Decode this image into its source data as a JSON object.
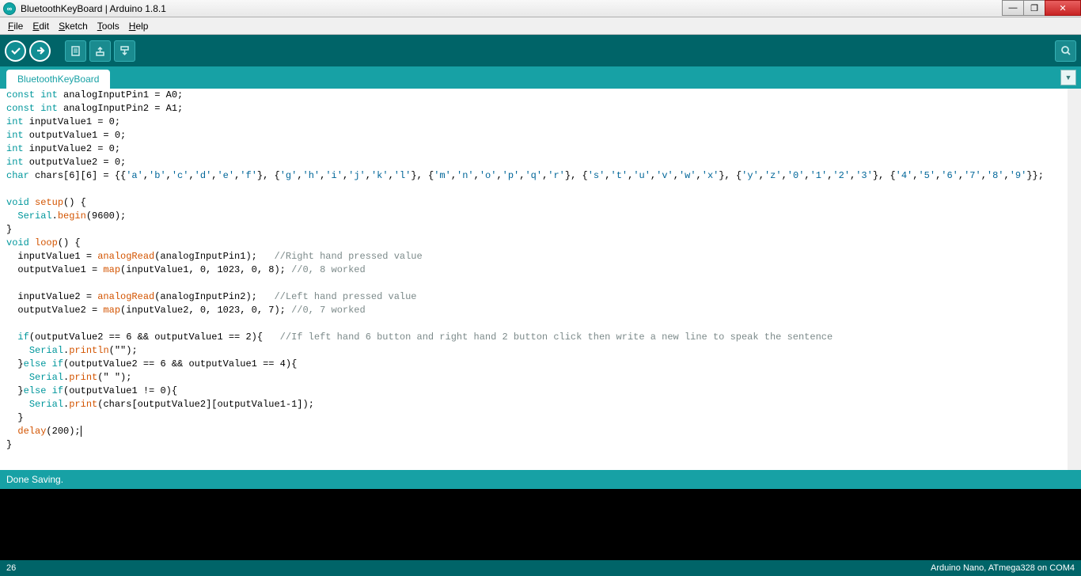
{
  "titlebar": {
    "app_icon_text": "∞",
    "title": "BluetoothKeyBoard | Arduino 1.8.1"
  },
  "window_controls": {
    "minimize": "—",
    "maximize": "❐",
    "close": "✕"
  },
  "menubar": {
    "file": "File",
    "edit": "Edit",
    "sketch": "Sketch",
    "tools": "Tools",
    "help": "Help"
  },
  "toolbar": {
    "verify_tip": "Verify",
    "upload_tip": "Upload",
    "new_tip": "New",
    "open_tip": "Open",
    "save_tip": "Save",
    "serial_tip": "Serial Monitor"
  },
  "tabs": {
    "active": "BluetoothKeyBoard"
  },
  "code": {
    "lines": [
      {
        "t": "decl",
        "tokens": [
          "const",
          "int",
          "analogInputPin1",
          "=",
          "A0",
          ";"
        ]
      },
      {
        "t": "decl",
        "tokens": [
          "const",
          "int",
          "analogInputPin2",
          "=",
          "A1",
          ";"
        ]
      },
      {
        "t": "decl",
        "tokens": [
          "int",
          "inputValue1",
          "=",
          "0",
          ";"
        ]
      },
      {
        "t": "decl",
        "tokens": [
          "int",
          "outputValue1",
          "=",
          "0",
          ";"
        ]
      },
      {
        "t": "decl",
        "tokens": [
          "int",
          "inputValue2",
          "=",
          "0",
          ";"
        ]
      },
      {
        "t": "decl",
        "tokens": [
          "int",
          "outputValue2",
          "=",
          "0",
          ";"
        ]
      },
      {
        "t": "chararr",
        "prefix": "char chars[6][6] = ",
        "groups": [
          [
            "'a'",
            "'b'",
            "'c'",
            "'d'",
            "'e'",
            "'f'"
          ],
          [
            "'g'",
            "'h'",
            "'i'",
            "'j'",
            "'k'",
            "'l'"
          ],
          [
            "'m'",
            "'n'",
            "'o'",
            "'p'",
            "'q'",
            "'r'"
          ],
          [
            "'s'",
            "'t'",
            "'u'",
            "'v'",
            "'w'",
            "'x'"
          ],
          [
            "'y'",
            "'z'",
            "'0'",
            "'1'",
            "'2'",
            "'3'"
          ],
          [
            "'4'",
            "'5'",
            "'6'",
            "'7'",
            "'8'",
            "'9'"
          ]
        ]
      },
      {
        "t": "blank"
      },
      {
        "t": "func",
        "kw": "void",
        "name": "setup",
        "sig": "() {"
      },
      {
        "t": "call",
        "indent": 1,
        "obj": "Serial",
        "method": "begin",
        "args": "(9600);"
      },
      {
        "t": "raw",
        "text": "}"
      },
      {
        "t": "func",
        "kw": "void",
        "name": "loop",
        "sig": "() {"
      },
      {
        "t": "assign",
        "indent": 1,
        "lhs": "inputValue1",
        "rhs_fn": "analogRead",
        "rhs_args": "(analogInputPin1);",
        "comment": "//Right hand pressed value"
      },
      {
        "t": "assign",
        "indent": 1,
        "lhs": "outputValue1",
        "rhs_fn": "map",
        "rhs_args": "(inputValue1, 0, 1023, 0, 8);",
        "comment": "//0, 8 worked"
      },
      {
        "t": "blank"
      },
      {
        "t": "assign",
        "indent": 1,
        "lhs": "inputValue2",
        "rhs_fn": "analogRead",
        "rhs_args": "(analogInputPin2);",
        "comment": "//Left hand pressed value"
      },
      {
        "t": "assign",
        "indent": 1,
        "lhs": "outputValue2",
        "rhs_fn": "map",
        "rhs_args": "(inputValue2, 0, 1023, 0, 7);",
        "comment": "//0, 7 worked"
      },
      {
        "t": "blank"
      },
      {
        "t": "if",
        "indent": 1,
        "cond": "outputValue2 == 6 && outputValue1 == 2",
        "comment": "//If left hand 6 button and right hand 2 button click then write a new line to speak the sentence"
      },
      {
        "t": "call",
        "indent": 2,
        "obj": "Serial",
        "method": "println",
        "args": "(\"\");"
      },
      {
        "t": "elseif",
        "indent": 1,
        "cond": "outputValue2 == 6 && outputValue1 == 4"
      },
      {
        "t": "call",
        "indent": 2,
        "obj": "Serial",
        "method": "print",
        "args": "(\" \");"
      },
      {
        "t": "elseif",
        "indent": 1,
        "cond": "outputValue1 != 0"
      },
      {
        "t": "call",
        "indent": 2,
        "obj": "Serial",
        "method": "print",
        "args": "(chars[outputValue2][outputValue1-1]);"
      },
      {
        "t": "raw",
        "indent": 1,
        "text": "}"
      },
      {
        "t": "callplain",
        "indent": 1,
        "fn": "delay",
        "args": "(200);",
        "cursor": true
      },
      {
        "t": "raw",
        "text": "}"
      }
    ]
  },
  "status": {
    "message": "Done Saving."
  },
  "footer": {
    "line": "26",
    "board": "Arduino Nano, ATmega328 on COM4"
  }
}
